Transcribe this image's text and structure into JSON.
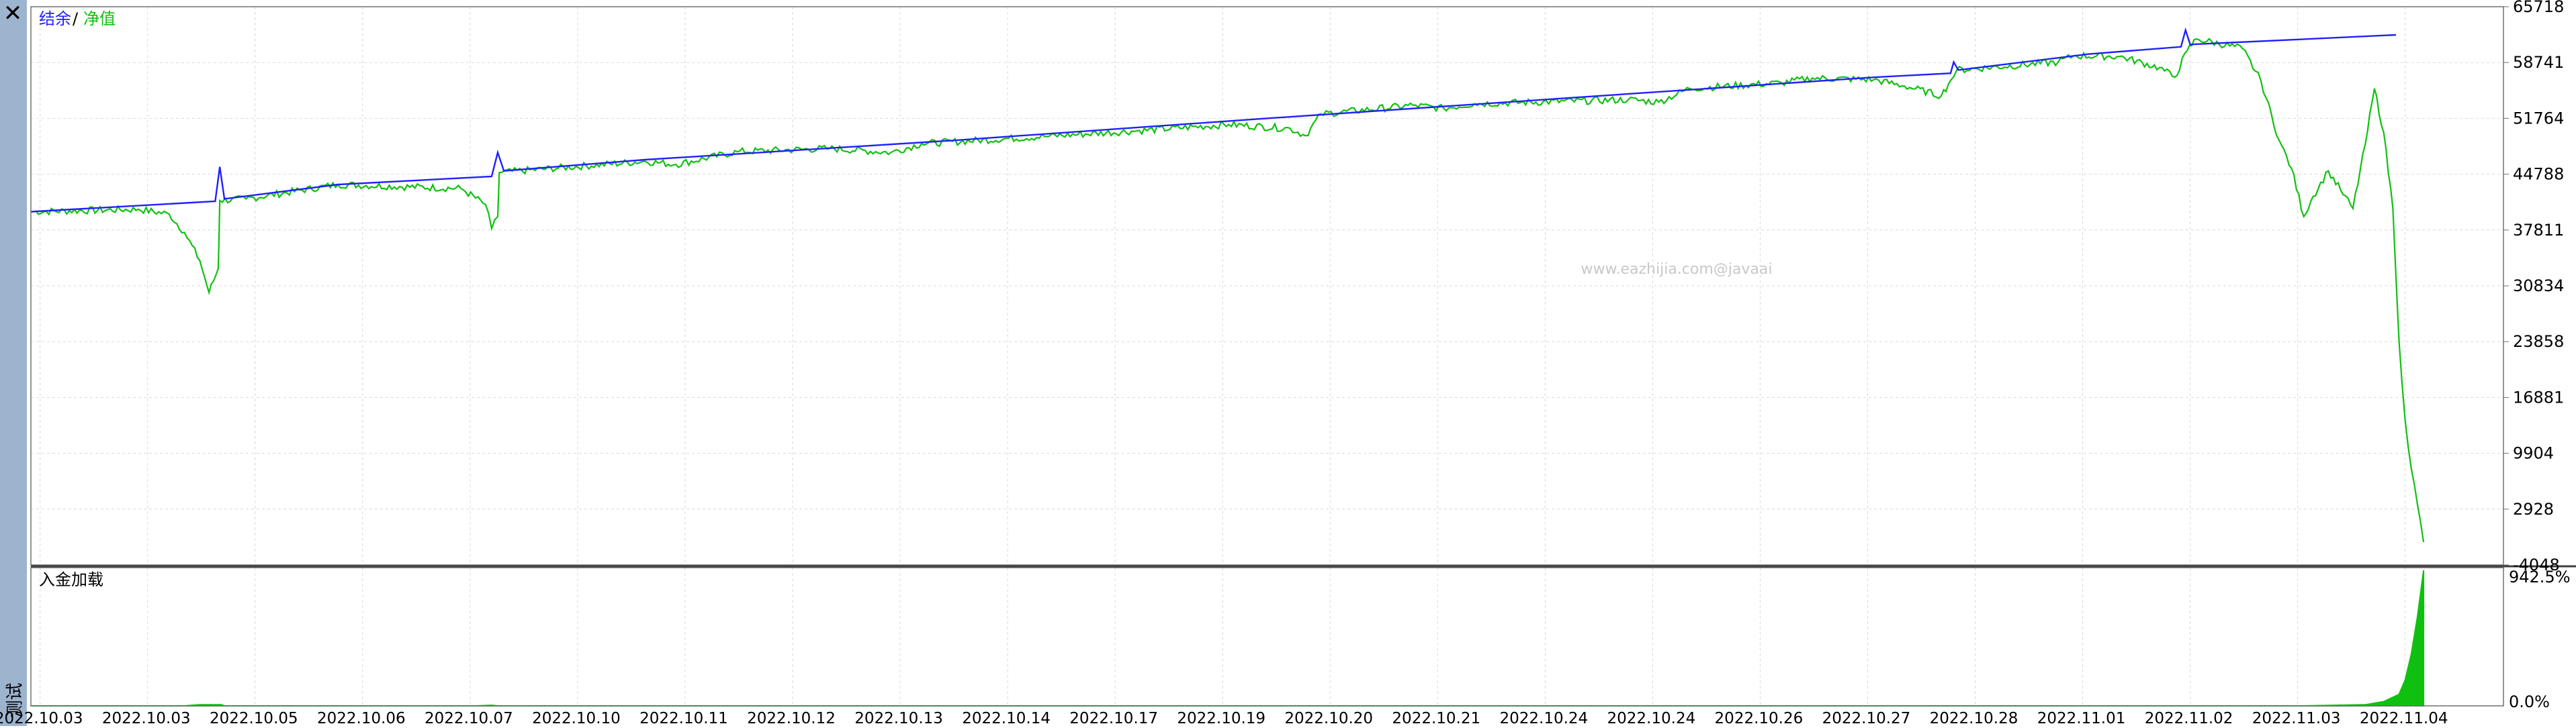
{
  "window": {
    "close_label": "✕",
    "panel_label": "测试"
  },
  "watermark": "www.eazhijia.com@javaai",
  "colors": {
    "balance": "#2020ff",
    "equity": "#10c010",
    "grid": "#d9d9d9",
    "border": "#707070",
    "load": "#10c010"
  },
  "chart_data": [
    {
      "type": "line",
      "legend": {
        "balance_label": "结余",
        "separator": "/",
        "equity_label": "净值"
      },
      "y_ticks": [
        "65718",
        "58741",
        "51764",
        "44788",
        "37811",
        "30834",
        "23858",
        "16881",
        "9904",
        "2928",
        "-4048"
      ],
      "ylim": [
        -4048,
        65718
      ],
      "x_tick_labels": [
        "2022.10.03",
        "2022.10.03",
        "2022.10.05",
        "2022.10.06",
        "2022.10.07",
        "2022.10.10",
        "2022.10.11",
        "2022.10.12",
        "2022.10.13",
        "2022.10.14",
        "2022.10.17",
        "2022.10.19",
        "2022.10.20",
        "2022.10.21",
        "2022.10.24",
        "2022.10.24",
        "2022.10.26",
        "2022.10.27",
        "2022.10.28",
        "2022.11.01",
        "2022.11.02",
        "2022.11.03",
        "2022.11.04"
      ],
      "series": [
        {
          "name": "结余",
          "points": [
            [
              0,
              40100
            ],
            [
              6,
              41400
            ],
            [
              6.15,
              45700
            ],
            [
              6.3,
              41700
            ],
            [
              10,
              43500
            ],
            [
              15,
              44500
            ],
            [
              15.2,
              47500
            ],
            [
              15.4,
              45200
            ],
            [
              20,
              46600
            ],
            [
              30,
              49000
            ],
            [
              40,
              51700
            ],
            [
              50,
              54300
            ],
            [
              60,
              56900
            ],
            [
              62.5,
              57400
            ],
            [
              62.6,
              58800
            ],
            [
              62.75,
              57800
            ],
            [
              67,
              59800
            ],
            [
              70,
              60700
            ],
            [
              70.15,
              62800
            ],
            [
              70.3,
              61000
            ],
            [
              77,
              62200
            ]
          ]
        },
        {
          "name": "净值",
          "points": [
            [
              0,
              40100
            ],
            [
              3.5,
              40400
            ],
            [
              4.5,
              39800
            ],
            [
              5,
              37500
            ],
            [
              5.5,
              34000
            ],
            [
              5.8,
              30000
            ],
            [
              6.1,
              33000
            ],
            [
              6.15,
              41500
            ],
            [
              7,
              41700
            ],
            [
              10,
              43500
            ],
            [
              14,
              43000
            ],
            [
              14.8,
              41000
            ],
            [
              15.0,
              38000
            ],
            [
              15.2,
              39500
            ],
            [
              15.25,
              45000
            ],
            [
              20,
              46400
            ],
            [
              21,
              46000
            ],
            [
              23,
              47600
            ],
            [
              26,
              48000
            ],
            [
              28,
              47500
            ],
            [
              29,
              48600
            ],
            [
              33,
              49500
            ],
            [
              36,
              50200
            ],
            [
              39,
              51000
            ],
            [
              41,
              50500
            ],
            [
              41.5,
              49600
            ],
            [
              42,
              52300
            ],
            [
              45,
              53400
            ],
            [
              46,
              53000
            ],
            [
              47,
              53600
            ],
            [
              52,
              54100
            ],
            [
              53,
              53800
            ],
            [
              54,
              55500
            ],
            [
              57,
              56200
            ],
            [
              58,
              56800
            ],
            [
              60,
              56600
            ],
            [
              61,
              55800
            ],
            [
              62.2,
              54600
            ],
            [
              62.5,
              56500
            ],
            [
              62.7,
              57800
            ],
            [
              66,
              58800
            ],
            [
              66.5,
              59600
            ],
            [
              68,
              59500
            ],
            [
              69.3,
              58100
            ],
            [
              69.8,
              56900
            ],
            [
              70.2,
              60200
            ],
            [
              70.5,
              61700
            ],
            [
              72,
              60500
            ],
            [
              72.6,
              56500
            ],
            [
              73.2,
              49000
            ],
            [
              73.6,
              45500
            ],
            [
              74.0,
              39500
            ],
            [
              74.3,
              42000
            ],
            [
              74.8,
              45200
            ],
            [
              75.2,
              42800
            ],
            [
              75.6,
              40500
            ],
            [
              76.0,
              48500
            ],
            [
              76.3,
              55500
            ],
            [
              76.6,
              50000
            ],
            [
              76.9,
              40500
            ],
            [
              77.1,
              24000
            ],
            [
              77.3,
              14000
            ],
            [
              77.5,
              8000
            ],
            [
              77.7,
              3500
            ],
            [
              77.9,
              -1200
            ]
          ]
        }
      ]
    },
    {
      "type": "area",
      "title": "入金加载",
      "y_ticks": [
        "942.5%",
        "0.0%"
      ],
      "ylim": [
        0,
        942.5
      ],
      "series": [
        {
          "name": "入金加载",
          "points": [
            [
              0,
              0
            ],
            [
              5,
              0
            ],
            [
              5.5,
              8
            ],
            [
              6.2,
              8
            ],
            [
              6.3,
              0
            ],
            [
              14.5,
              0
            ],
            [
              15,
              4
            ],
            [
              15.2,
              0
            ],
            [
              72,
              0
            ],
            [
              74,
              0
            ],
            [
              76,
              8
            ],
            [
              76.6,
              30
            ],
            [
              77.1,
              80
            ],
            [
              77.3,
              180
            ],
            [
              77.5,
              360
            ],
            [
              77.7,
              620
            ],
            [
              77.9,
              942.5
            ]
          ]
        }
      ]
    }
  ]
}
